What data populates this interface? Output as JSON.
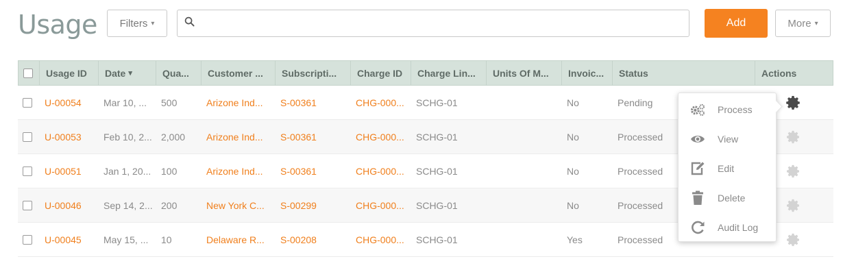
{
  "header": {
    "title": "Usage",
    "filters_label": "Filters",
    "search_placeholder": "",
    "add_label": "Add",
    "more_label": "More"
  },
  "table": {
    "columns": [
      "Usage ID",
      "Date",
      "Qua...",
      "Customer ...",
      "Subscripti...",
      "Charge ID",
      "Charge Lin...",
      "Units Of M...",
      "Invoic...",
      "Status",
      "Actions"
    ],
    "sort_indicator": "▾",
    "rows": [
      {
        "usage_id": "U-00054",
        "date": "Mar 10, ...",
        "quantity": "500",
        "customer": "Arizone Ind...",
        "subscription": "S-00361",
        "charge_id": "CHG-000...",
        "charge_line": "SCHG-01",
        "units": "",
        "invoiced": "No",
        "status": "Pending"
      },
      {
        "usage_id": "U-00053",
        "date": "Feb 10, 2...",
        "quantity": "2,000",
        "customer": "Arizone Ind...",
        "subscription": "S-00361",
        "charge_id": "CHG-000...",
        "charge_line": "SCHG-01",
        "units": "",
        "invoiced": "No",
        "status": "Processed"
      },
      {
        "usage_id": "U-00051",
        "date": "Jan 1, 20...",
        "quantity": "100",
        "customer": "Arizone Ind...",
        "subscription": "S-00361",
        "charge_id": "CHG-000...",
        "charge_line": "SCHG-01",
        "units": "",
        "invoiced": "No",
        "status": "Processed"
      },
      {
        "usage_id": "U-00046",
        "date": "Sep 14, 2...",
        "quantity": "200",
        "customer": "New York C...",
        "subscription": "S-00299",
        "charge_id": "CHG-000...",
        "charge_line": "SCHG-01",
        "units": "",
        "invoiced": "No",
        "status": "Processed"
      },
      {
        "usage_id": "U-00045",
        "date": "May 15, ...",
        "quantity": "10",
        "customer": "Delaware R...",
        "subscription": "S-00208",
        "charge_id": "CHG-000...",
        "charge_line": "SCHG-01",
        "units": "",
        "invoiced": "Yes",
        "status": "Processed"
      }
    ]
  },
  "actions_menu": {
    "items": [
      {
        "label": "Process",
        "icon": "gears-icon"
      },
      {
        "label": "View",
        "icon": "eye-icon"
      },
      {
        "label": "Edit",
        "icon": "edit-icon"
      },
      {
        "label": "Delete",
        "icon": "trash-icon"
      },
      {
        "label": "Audit Log",
        "icon": "history-icon"
      }
    ]
  },
  "colors": {
    "accent": "#f58220",
    "link": "#f07f1c",
    "header_bg": "#d6e2db",
    "title": "#8a9a99"
  }
}
